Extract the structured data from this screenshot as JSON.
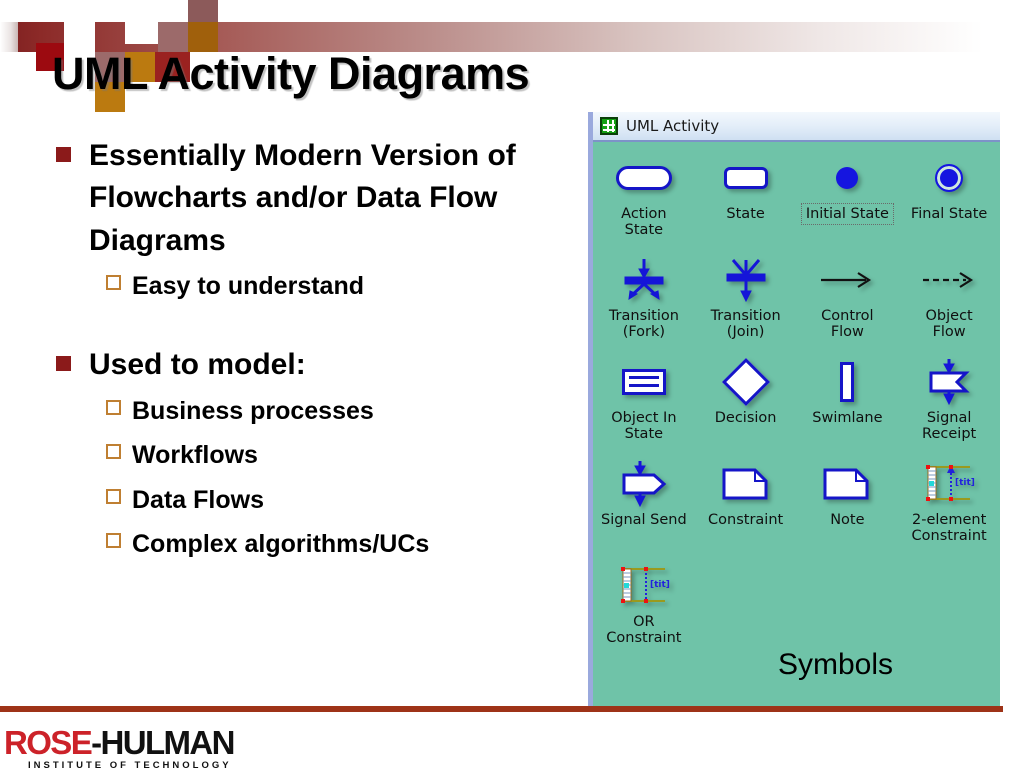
{
  "slide": {
    "title": "UML Activity Diagrams",
    "symbols_caption": "Symbols"
  },
  "decor": {
    "accent_dark_red": "#8b1a1a",
    "accent_orange": "#bf7f32",
    "bar_gradient_start": "#7e1f1f",
    "bar_gradient_end": "#ffffff",
    "footer_rule_color": "#9e3318",
    "panel_green": "#6fc3a8",
    "symbol_blue": "#1515c8"
  },
  "body": {
    "groups": [
      {
        "bullet": "Essentially Modern Version of Flowcharts and/or Data Flow Diagrams",
        "subitems": [
          "Easy to understand"
        ]
      },
      {
        "bullet": "Used to model:",
        "subitems": [
          "Business processes",
          "Workflows",
          "Data Flows",
          "Complex algorithms/UCs"
        ]
      }
    ]
  },
  "uml_window": {
    "title": "UML Activity",
    "title_icon": "grid-icon",
    "rows": [
      [
        {
          "icon": "action-state-icon",
          "label": "Action\nState",
          "selected": false
        },
        {
          "icon": "state-icon",
          "label": "State",
          "selected": false
        },
        {
          "icon": "initial-state-icon",
          "label": "Initial State",
          "selected": true
        },
        {
          "icon": "final-state-icon",
          "label": "Final State",
          "selected": false
        }
      ],
      [
        {
          "icon": "transition-fork-icon",
          "label": "Transition\n(Fork)",
          "selected": false
        },
        {
          "icon": "transition-join-icon",
          "label": "Transition\n(Join)",
          "selected": false
        },
        {
          "icon": "control-flow-icon",
          "label": "Control\nFlow",
          "selected": false
        },
        {
          "icon": "object-flow-icon",
          "label": "Object\nFlow",
          "selected": false
        }
      ],
      [
        {
          "icon": "object-in-state-icon",
          "label": "Object In\nState",
          "selected": false
        },
        {
          "icon": "decision-icon",
          "label": "Decision",
          "selected": false
        },
        {
          "icon": "swimlane-icon",
          "label": "Swimlane",
          "selected": false
        },
        {
          "icon": "signal-receipt-icon",
          "label": "Signal\nReceipt",
          "selected": false
        }
      ],
      [
        {
          "icon": "signal-send-icon",
          "label": "Signal Send",
          "selected": false
        },
        {
          "icon": "constraint-icon",
          "label": "Constraint",
          "selected": false
        },
        {
          "icon": "note-icon",
          "label": "Note",
          "selected": false
        },
        {
          "icon": "two-element-constraint-icon",
          "label": "2-element\nConstraint",
          "selected": false
        }
      ],
      [
        {
          "icon": "or-constraint-icon",
          "label": "OR\nConstraint",
          "selected": false
        }
      ]
    ]
  },
  "footer": {
    "logo_primary": "ROSE",
    "logo_secondary": "-HULMAN",
    "logo_tagline": "INSTITUTE OF TECHNOLOGY"
  }
}
